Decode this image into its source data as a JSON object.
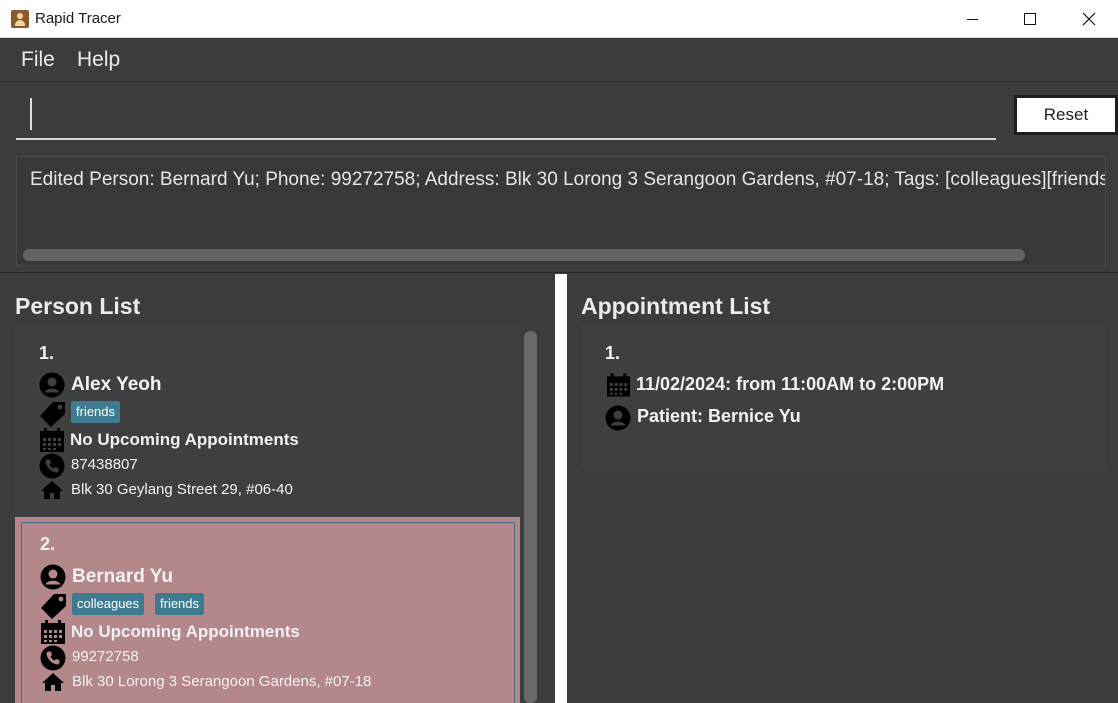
{
  "window": {
    "title": "Rapid Tracer"
  },
  "menu": {
    "file": "File",
    "help": "Help"
  },
  "command": {
    "value": "",
    "reset_label": "Reset"
  },
  "result": {
    "text": "Edited Person: Bernard Yu; Phone: 99272758; Address: Blk 30 Lorong 3 Serangoon Gardens, #07-18; Tags: [colleagues][friends]"
  },
  "person_list": {
    "title": "Person List",
    "persons": [
      {
        "index": "1.",
        "name": "Alex Yeoh",
        "tags": [
          "friends"
        ],
        "appointments": "No Upcoming Appointments",
        "phone": "87438807",
        "address": "Blk 30 Geylang Street 29, #06-40"
      },
      {
        "index": "2.",
        "name": "Bernard Yu",
        "tags": [
          "colleagues",
          "friends"
        ],
        "appointments": "No Upcoming Appointments",
        "phone": "99272758",
        "address": "Blk 30 Lorong 3 Serangoon Gardens, #07-18"
      }
    ]
  },
  "appointment_list": {
    "title": "Appointment List",
    "appointments": [
      {
        "index": "1.",
        "datetime": "11/02/2024: from 11:00AM to 2:00PM",
        "patient": "Patient: Bernice Yu"
      }
    ]
  },
  "colors": {
    "selected_card": "#b4878a",
    "tag": "#3e7b91",
    "background": "#3c3c3c"
  }
}
